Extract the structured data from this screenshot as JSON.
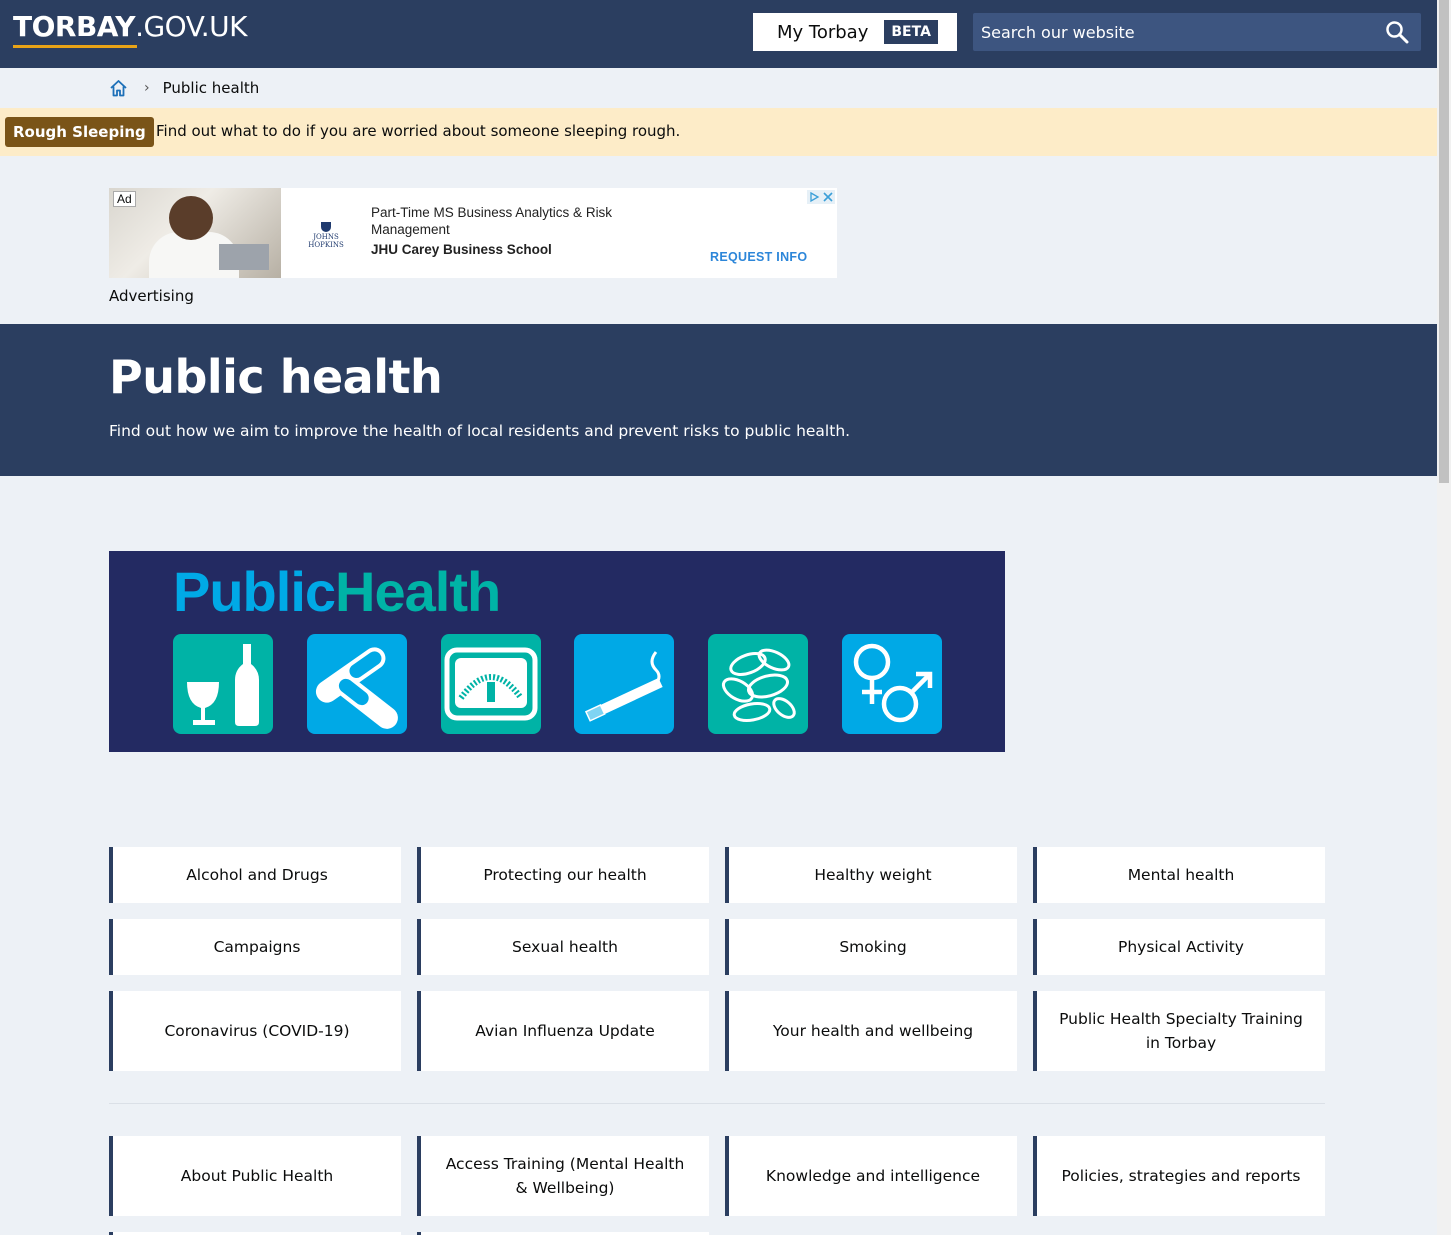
{
  "header": {
    "logo_bold": "TORBAY",
    "logo_rest": ".GOV.UK",
    "my_torbay_label": "My Torbay",
    "beta_label": "BETA",
    "search_placeholder": "Search our website"
  },
  "breadcrumb": {
    "current": "Public health"
  },
  "notice": {
    "tag": "Rough Sleeping",
    "text": "Find out what to do if you are worried about someone sleeping rough."
  },
  "ad": {
    "ad_label": "Ad",
    "title": "Part-Time MS Business Analytics & Risk Management",
    "advertiser": "JHU Carey Business School",
    "cta": "REQUEST INFO",
    "logo_text": "JOHNS HOPKINS",
    "caption": "Advertising"
  },
  "hero": {
    "title": "Public health",
    "subtitle": "Find out how we aim to improve the health of local residents and prevent risks to public health."
  },
  "banner": {
    "title_part1": "Public",
    "title_part2": "Health",
    "icons": [
      "alcohol-icon",
      "pills-icon",
      "weighing-scale-icon",
      "cigarette-icon",
      "bacteria-icon",
      "gender-symbols-icon"
    ],
    "colors": {
      "navy": "#232a62",
      "teal": "#00b3a6",
      "blue": "#00a9e6"
    }
  },
  "links": {
    "group1": [
      "Alcohol and Drugs",
      "Protecting our health",
      "Healthy weight",
      "Mental health",
      "Campaigns",
      "Sexual health",
      "Smoking",
      "Physical Activity",
      "Coronavirus (COVID-19)",
      "Avian Influenza Update",
      "Your health and wellbeing",
      "Public Health Specialty Training in Torbay"
    ],
    "group2": [
      "About Public Health",
      "Access Training (Mental Health & Wellbeing)",
      "Knowledge and intelligence",
      "Policies, strategies and reports"
    ]
  },
  "colors": {
    "header_bg": "#2b3e60",
    "page_bg": "#edf1f6",
    "notice_bg": "#fdecc8",
    "notice_tag_bg": "#7a5418",
    "logo_underline": "#e8a317"
  }
}
